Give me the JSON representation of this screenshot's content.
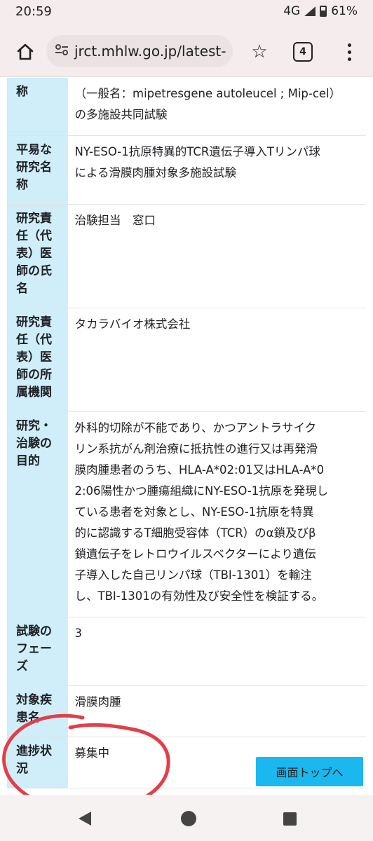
{
  "status_bar": {
    "time": "20:59",
    "network": "4G",
    "battery": "61%"
  },
  "browser": {
    "url": "jrct.mhlw.go.jp/latest-",
    "tab_count": "4",
    "icons": {
      "home": "home-icon",
      "site_settings": "tune-icon",
      "bookmark": "star-icon",
      "menu": "more-vert-icon"
    }
  },
  "table": {
    "rows": [
      {
        "label": "称",
        "value": "（一般名：mipetresgene autoleucel ; Mip-cel）\nの多施設共同試験"
      },
      {
        "label": "平易な\n研究名\n称",
        "value": "NY-ESO-1抗原特異的TCR遺伝子導入Tリンパ球\nによる滑膜肉腫対象多施設試験"
      },
      {
        "label": "研究責\n任（代\n表）医\n師の氏\n名",
        "value": "治験担当　窓口"
      },
      {
        "label": "研究責\n任（代\n表）医\n師の所\n属機関",
        "value": "タカラバイオ株式会社"
      },
      {
        "label": "研究・\n治験の\n目的",
        "value": "外科的切除が不能であり、かつアントラサイク\nリン系抗がん剤治療に抵抗性の進行又は再発滑\n膜肉腫患者のうち、HLA-A*02:01又はHLA-A*0\n2:06陽性かつ腫瘍組織にNY-ESO-1抗原を発現し\nている患者を対象とし、NY-ESO-1抗原を特異\n的に認識するT細胞受容体（TCR）のα鎖及びβ\n鎖遺伝子をレトロウイルスベクターにより遺伝\n子導入した自己リンパ球（TBI-1301）を輸注\nし、TBI-1301の有効性及び安全性を検証する。"
      },
      {
        "label": "試験の\nフェー\nズ",
        "value": "3"
      },
      {
        "label": "対象疾\n患名",
        "value": "滑膜肉腫"
      },
      {
        "label": "進捗状\n況",
        "value": "募集中"
      }
    ]
  },
  "scroll_top_button": {
    "label": "画面トップへ"
  },
  "annotation": {
    "color": "#e0404a"
  },
  "nav_bar": {
    "icons": {
      "back": "back-icon",
      "home": "home-circle-icon",
      "recents": "recents-icon"
    }
  }
}
